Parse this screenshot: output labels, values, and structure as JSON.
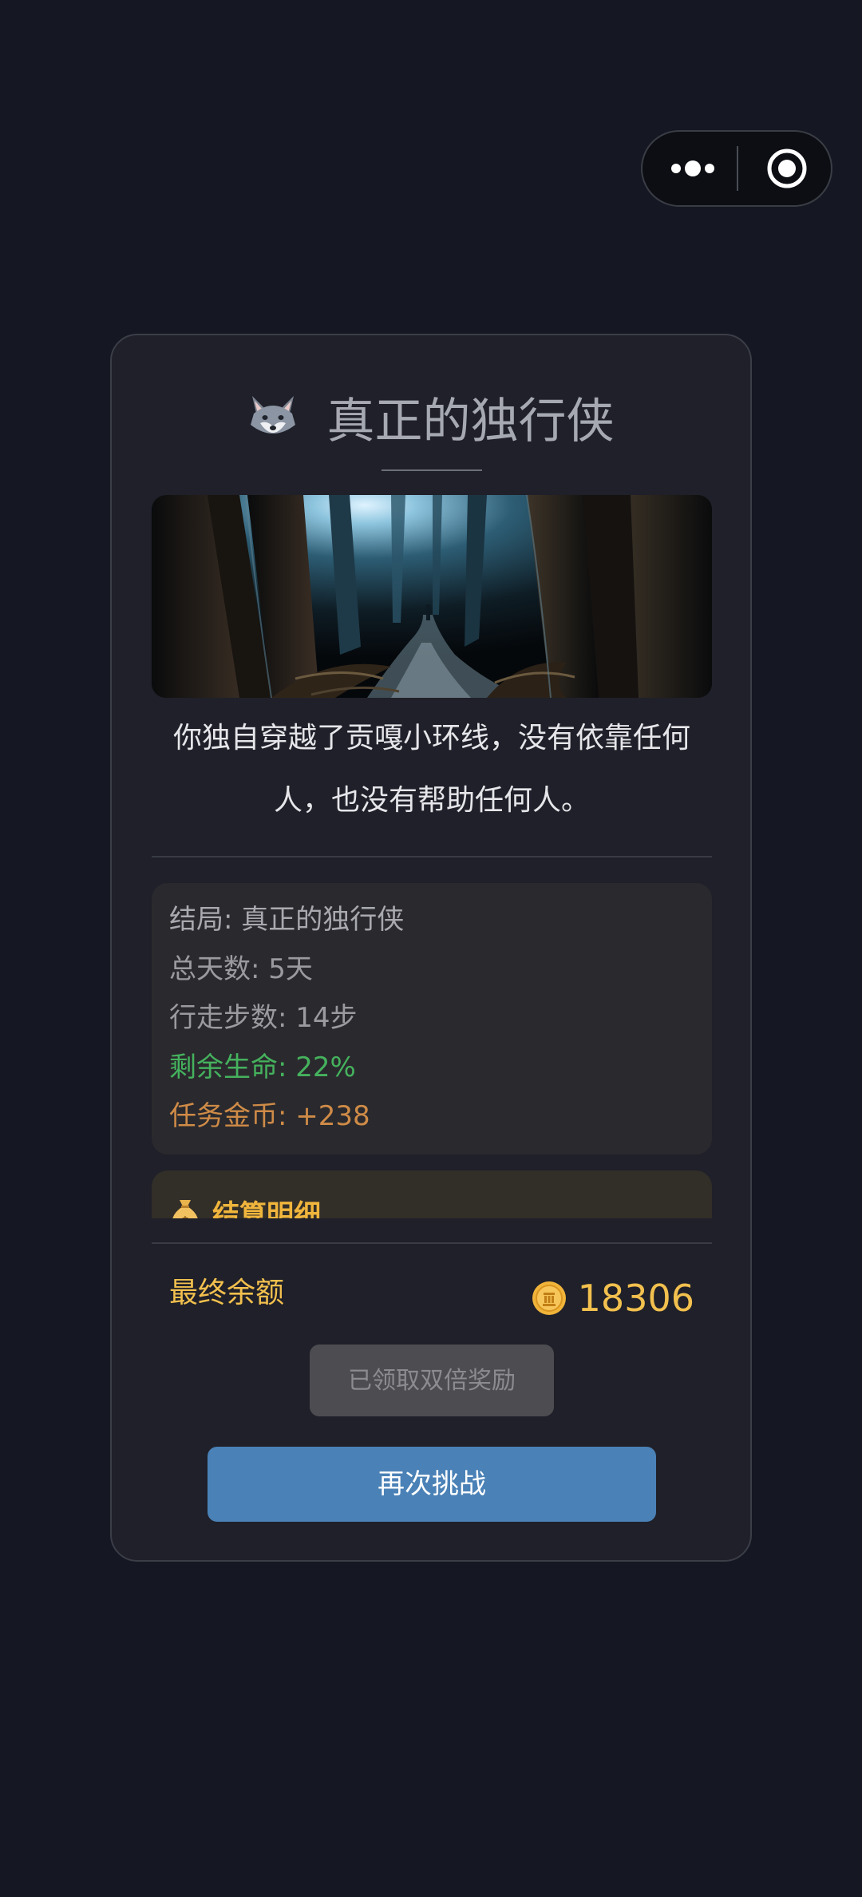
{
  "capsule": {
    "more_icon": "more-dots-icon",
    "close_icon": "target-circle-icon"
  },
  "card": {
    "title_icon": "wolf-face-icon",
    "title": "真正的独行侠",
    "scene_image": "dark forest path with lone traveler",
    "description": "你独自穿越了贡嘎小环线，没有依靠任何人，也没有帮助任何人。",
    "stats": {
      "ending": "结局: 真正的独行侠",
      "days": "总天数: 5天",
      "steps": "行走步数: 14步",
      "life": "剩余生命: 22%",
      "gold": "任务金币: +238"
    },
    "details": {
      "icon": "money-bag-icon",
      "label": "结算明细"
    },
    "balance": {
      "label": "最终余额",
      "coin_icon": "gold-coin-icon",
      "amount": "18306"
    },
    "buttons": {
      "claimed": "已领取双倍奖励",
      "retry": "再次挑战"
    }
  },
  "colors": {
    "background": "#151822",
    "card": "#1f2029",
    "gold": "#f2c04e",
    "life_green": "#45b25d",
    "coin_orange": "#cf8b47",
    "retry_blue": "#4a81b6"
  }
}
